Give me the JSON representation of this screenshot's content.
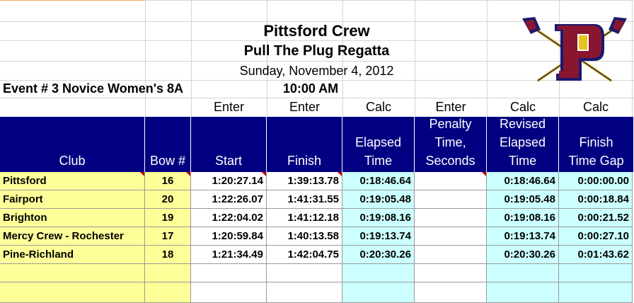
{
  "title": "Pittsford Crew",
  "subtitle": "Pull The Plug Regatta",
  "date": "Sunday, November 4, 2012",
  "event": "Event # 3  Novice Women's 8A",
  "time": "10:00 AM",
  "modes": [
    "Enter",
    "Enter",
    "Calc",
    "Enter",
    "Calc",
    "Calc"
  ],
  "headers": {
    "club": "Club",
    "bow": "Bow #",
    "start": "Start",
    "finish": "Finish",
    "elapsed": "Elapsed\nTime",
    "penalty": "Penalty\nTime,\nSeconds",
    "revised": "Revised\nElapsed\nTime",
    "gap": "Finish\nTime Gap"
  },
  "rows": [
    {
      "club": "Pittsford",
      "bow": "16",
      "start": "1:20:27.14",
      "finish": "1:39:13.78",
      "elapsed": "0:18:46.64",
      "penalty": "",
      "revised": "0:18:46.64",
      "gap": "0:00:00.00"
    },
    {
      "club": "Fairport",
      "bow": "20",
      "start": "1:22:26.07",
      "finish": "1:41:31.55",
      "elapsed": "0:19:05.48",
      "penalty": "",
      "revised": "0:19:05.48",
      "gap": "0:00:18.84"
    },
    {
      "club": "Brighton",
      "bow": "19",
      "start": "1:22:04.02",
      "finish": "1:41:12.18",
      "elapsed": "0:19:08.16",
      "penalty": "",
      "revised": "0:19:08.16",
      "gap": "0:00:21.52"
    },
    {
      "club": "Mercy Crew - Rochester",
      "bow": "17",
      "start": "1:20:59.84",
      "finish": "1:40:13.58",
      "elapsed": "0:19:13.74",
      "penalty": "",
      "revised": "0:19:13.74",
      "gap": "0:00:27.10"
    },
    {
      "club": "Pine-Richland",
      "bow": "18",
      "start": "1:21:34.49",
      "finish": "1:42:04.75",
      "elapsed": "0:20:30.26",
      "penalty": "",
      "revised": "0:20:30.26",
      "gap": "0:01:43.62"
    },
    {
      "club": "",
      "bow": "",
      "start": "",
      "finish": "",
      "elapsed": "",
      "penalty": "",
      "revised": "",
      "gap": ""
    },
    {
      "club": "",
      "bow": "",
      "start": "",
      "finish": "",
      "elapsed": "",
      "penalty": "",
      "revised": "",
      "gap": ""
    }
  ],
  "logo_letter": "P",
  "colors": {
    "header_bg": "#000080",
    "yellow": "#ffff99",
    "cyan": "#ccffff",
    "comment_marker": "#c00000",
    "logo_navy": "#1a1a6e",
    "logo_maroon": "#8a1530",
    "logo_gold": "#e8c420"
  }
}
